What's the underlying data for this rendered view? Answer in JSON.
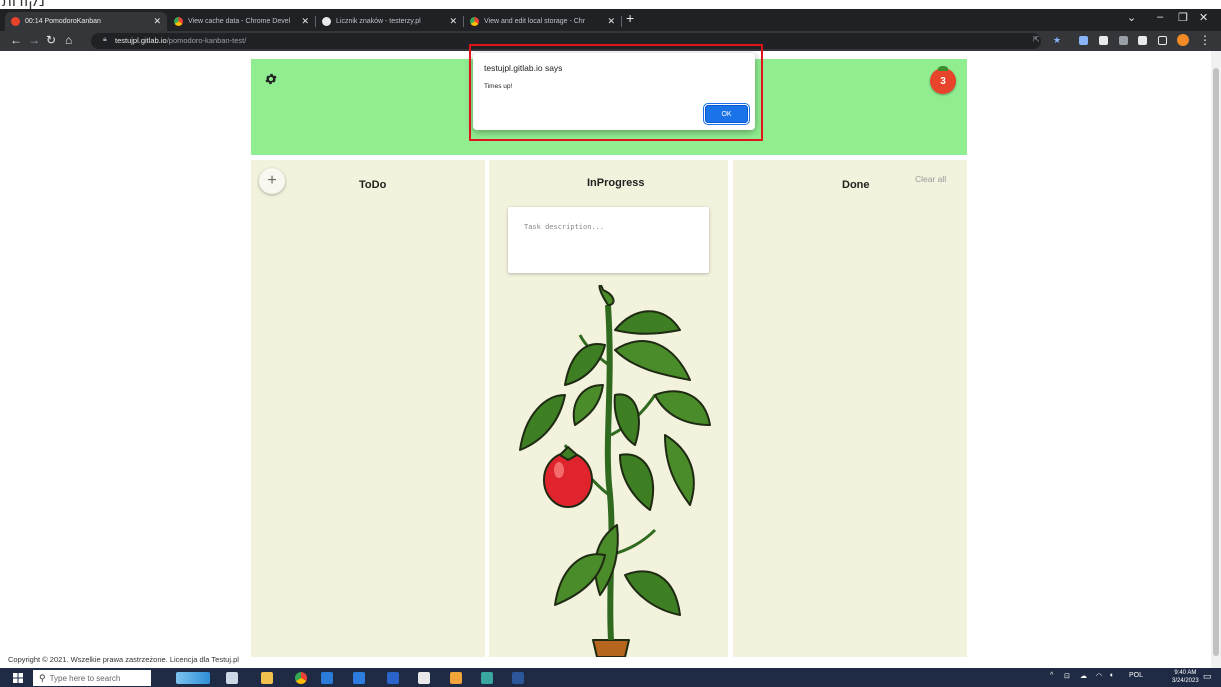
{
  "top_strip_text": "נקודות",
  "browser": {
    "tabs": [
      {
        "title": "00:14 PomodoroKanban",
        "active": true
      },
      {
        "title": "View cache data - Chrome Devel",
        "active": false
      },
      {
        "title": "Licznik znaków - testerzy.pl",
        "active": false
      },
      {
        "title": "View and edit local storage - Chr",
        "active": false
      }
    ],
    "new_tab_label": "+",
    "url_host": "testujpl.gitlab.io",
    "url_path": "/pomodoro-kanban-test/"
  },
  "header": {
    "tomato_count": "3"
  },
  "columns": {
    "todo": {
      "title": "ToDo"
    },
    "inprogress": {
      "title": "InProgress"
    },
    "done": {
      "title": "Done",
      "clear_label": "Clear all"
    }
  },
  "add_label": "+",
  "task": {
    "placeholder": "Task description..."
  },
  "dialog": {
    "title": "testujpl.gitlab.io says",
    "message": "Times up!",
    "ok_label": "OK"
  },
  "footer": {
    "text": "Copyright © 2021. Wszelkie prawa zastrzeżone. Licencja dla Testuj.pl"
  },
  "taskbar": {
    "search_placeholder": "Type here to search",
    "language": "POL",
    "time": "9:40 AM",
    "date": "3/24/2023"
  },
  "colors": {
    "header_green": "#90ee90",
    "column_bg": "#f2f2dd",
    "dialog_button": "#1a73e8",
    "highlight_red": "#e0151b",
    "tomato": "#e8432b"
  }
}
